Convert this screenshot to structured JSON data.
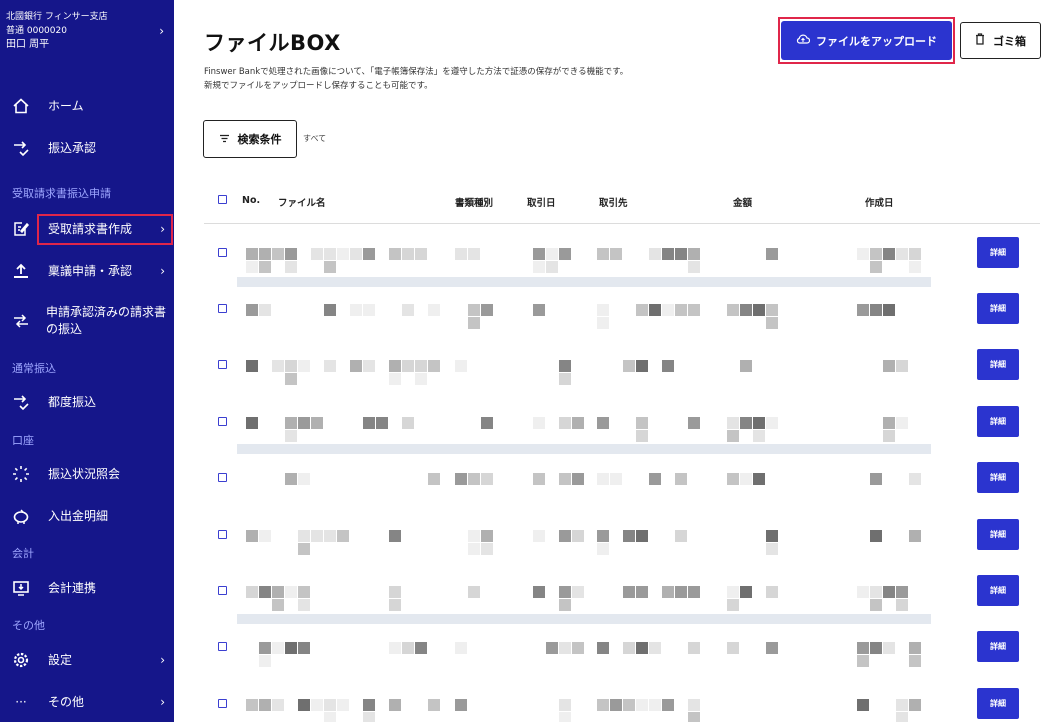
{
  "account": {
    "bank": "北國銀行 フィンサー支店",
    "number": "普通 0000020",
    "user": "田口 周平"
  },
  "sidebar": {
    "home": "ホーム",
    "transfer_approval": "振込承認",
    "section_invoice": "受取請求書振込申請",
    "invoice_create": "受取請求書作成",
    "ringi": "稟議申請・承認",
    "approved_invoice": "申請承認済みの請求書の振込",
    "section_normal": "通常振込",
    "each_transfer": "都度振込",
    "section_account": "口座",
    "transfer_status": "振込状況照会",
    "statement": "入出金明細",
    "section_accounting": "会計",
    "accounting_link": "会計連携",
    "section_other": "その他",
    "settings": "設定",
    "other": "その他"
  },
  "header": {
    "title": "ファイルBOX",
    "desc_line1": "Finswer Bankで処理された画像について、「電子帳簿保存法」を遵守した方法で証憑の保存ができる機能です。",
    "desc_line2": "新規でファイルをアップロードし保存することも可能です。",
    "upload": "ファイルをアップロード",
    "trash": "ゴミ箱"
  },
  "search": {
    "button": "検索条件",
    "summary": "すべて"
  },
  "table": {
    "columns": [
      "No.",
      "ファイル名",
      "書類種別",
      "取引日",
      "取引先",
      "金額",
      "作成日"
    ],
    "detail_label": "詳細"
  }
}
